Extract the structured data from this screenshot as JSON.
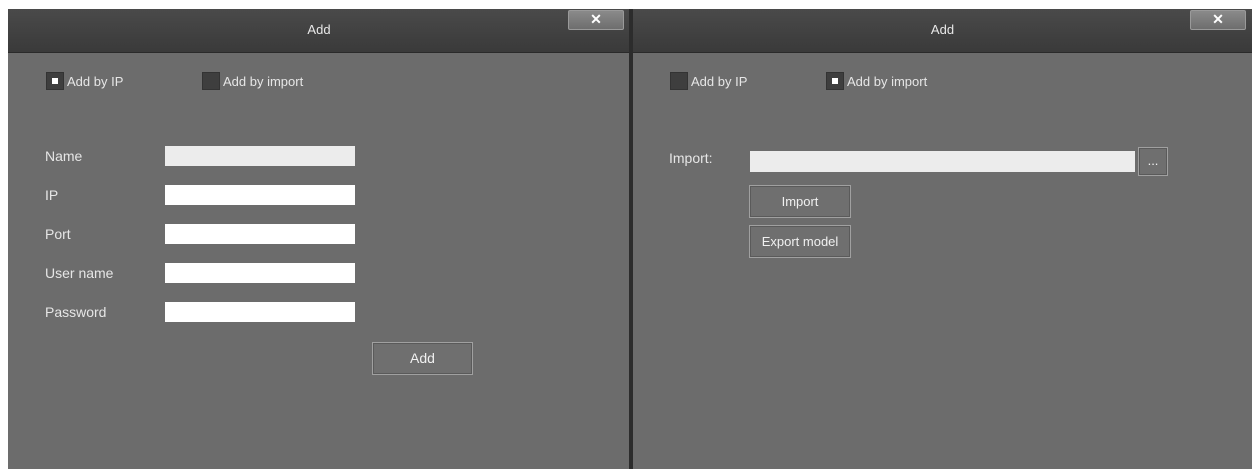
{
  "left_dialog": {
    "title": "Add",
    "close_glyph": "✕",
    "mode_options": {
      "by_ip": {
        "label": "Add by IP",
        "checked": true
      },
      "by_import": {
        "label": "Add by import",
        "checked": false
      }
    },
    "fields": {
      "name": {
        "label": "Name",
        "value": ""
      },
      "ip": {
        "label": "IP",
        "value": ""
      },
      "port": {
        "label": "Port",
        "value": ""
      },
      "username": {
        "label": "User name",
        "value": ""
      },
      "password": {
        "label": "Password",
        "value": ""
      }
    },
    "add_button": "Add"
  },
  "right_dialog": {
    "title": "Add",
    "close_glyph": "✕",
    "mode_options": {
      "by_ip": {
        "label": "Add by IP",
        "checked": false
      },
      "by_import": {
        "label": "Add by import",
        "checked": true
      }
    },
    "import_label": "Import:",
    "import_path": "",
    "browse_button": "...",
    "import_button": "Import",
    "export_model_button": "Export model"
  },
  "colors": {
    "panel_bg": "#6c6c6c",
    "titlebar_bg": "#3f3f3f",
    "text": "#e6e6e6",
    "input_bg": "#ffffff"
  }
}
